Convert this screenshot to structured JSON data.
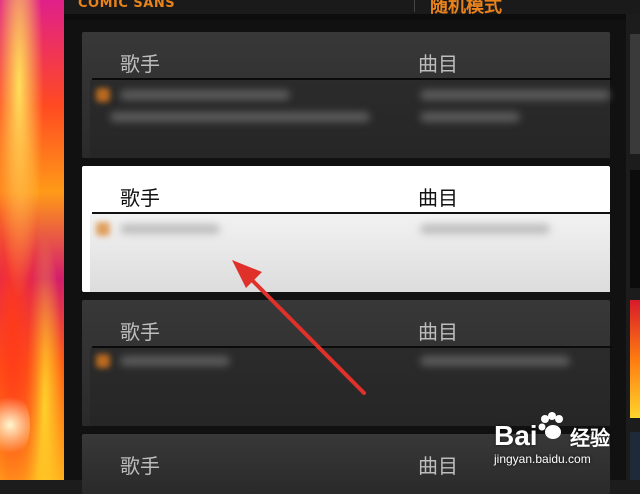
{
  "header": {
    "left_label": "COMIC SANS",
    "right_label": "随机模式"
  },
  "list": {
    "columns": {
      "artist": "歌手",
      "track": "曲目"
    },
    "cards": [
      {
        "state": "normal"
      },
      {
        "state": "selected"
      },
      {
        "state": "normal"
      },
      {
        "state": "normal"
      }
    ]
  },
  "colors": {
    "accent": "#e8821d",
    "annotation_arrow": "#e0302a",
    "card_dark": "#333333",
    "card_selected": "#ffffff"
  },
  "watermark": {
    "brand": "Bai",
    "brand_suffix": "du",
    "chinese": "经验",
    "url": "jingyan.baidu.com",
    "icon": "paw-icon"
  }
}
